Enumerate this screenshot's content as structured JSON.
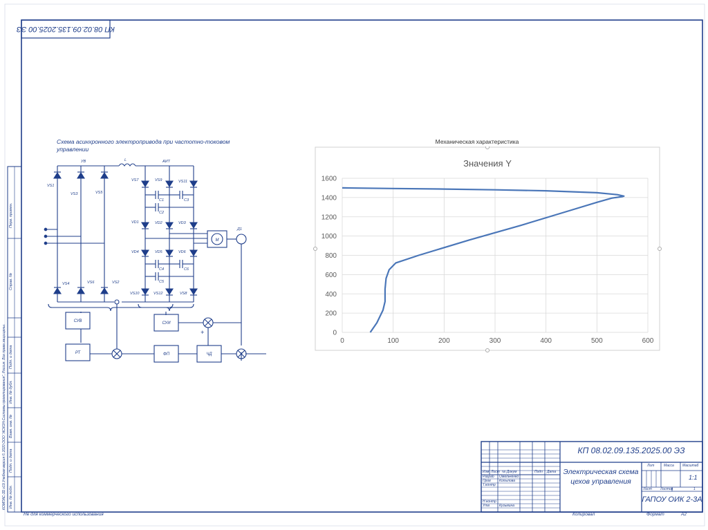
{
  "sheet": {
    "top_code": "КП 08.02.09.135.2025.00 ЭЗ",
    "bottom_left_note": "Не для коммерческого использования",
    "bottom_copied": "Копировал",
    "bottom_format": "Формат",
    "bottom_format_value": "А2",
    "left_strip": {
      "perv_primen": "Перв. примен.",
      "sprav_no": "Справ. №",
      "podp_data_1": "Подп. и дата",
      "inv_dubl": "Инв. № дубл.",
      "vzam_inv": "Взам. инв. №",
      "podp_data_2": "Подп. и дата",
      "inv_podl": "Инв. № подл.",
      "license_note": "КОМПАС-3D v19 Учебная версия © 2020 ООО \"АСКОН-Системы проектирования\", Россия. Все права защищены."
    }
  },
  "schematic": {
    "title_line1": "Схема асинхронного электропривода при частотно-токовом",
    "title_line2": "управлении",
    "labels": {
      "uv": "УВ",
      "l": "L",
      "ain": "АИТ",
      "m": "М",
      "d1": "Д1",
      "su": "СУВ",
      "rt": "РТ",
      "fp": "ФП",
      "chd": "ЧД",
      "sui": "СУИ",
      "vs1": "VS1",
      "vs3": "VS3",
      "vs5": "VS5",
      "vs4": "VS4",
      "vs6": "VS6",
      "vs2": "VS2",
      "vs7": "VS7",
      "vs9": "VS9",
      "vs11": "VS11",
      "vd1": "VD1",
      "vd2": "VD2",
      "vd3": "VD3",
      "vd4": "VD4",
      "vd5": "VD5",
      "vd6": "VD6",
      "vs10": "VS10",
      "vs12": "VS12",
      "vs8": "VS8",
      "c1": "C1",
      "c2": "C2",
      "c3": "C3",
      "c4": "C4",
      "c5": "C5",
      "c6": "C6",
      "plus": "+"
    }
  },
  "chart_caption": "Механическая характеристика",
  "chart_data": {
    "type": "line",
    "title": "Значения Y",
    "xlabel": "",
    "ylabel": "",
    "xlim": [
      0,
      600
    ],
    "ylim": [
      0,
      1600
    ],
    "xticks": [
      0,
      100,
      200,
      300,
      400,
      500,
      600
    ],
    "yticks": [
      0,
      200,
      400,
      600,
      800,
      1000,
      1200,
      1400,
      1600
    ],
    "grid": true,
    "legend": "none",
    "color": "#4a76b8",
    "series": [
      {
        "points": [
          [
            55,
            0
          ],
          [
            68,
            100
          ],
          [
            80,
            230
          ],
          [
            84,
            320
          ],
          [
            84,
            450
          ],
          [
            86,
            560
          ],
          [
            92,
            650
          ],
          [
            105,
            720
          ],
          [
            150,
            800
          ],
          [
            250,
            960
          ],
          [
            350,
            1110
          ],
          [
            450,
            1270
          ],
          [
            500,
            1350
          ],
          [
            530,
            1395
          ],
          [
            550,
            1410
          ],
          [
            553,
            1415
          ],
          [
            540,
            1430
          ],
          [
            500,
            1450
          ],
          [
            400,
            1470
          ],
          [
            300,
            1480
          ],
          [
            200,
            1488
          ],
          [
            100,
            1494
          ],
          [
            0,
            1500
          ]
        ]
      }
    ]
  },
  "title_block": {
    "doc_code": "КП 08.02.09.135.2025.00 ЭЗ",
    "doc_title_line1": "Электрическая схема",
    "doc_title_line2": "цехов управления",
    "org": "ГАПОУ ОИК 2-3А",
    "col_izm": "Изм",
    "col_list": "Лист",
    "col_docum": "№ Докум",
    "col_podp": "Подп",
    "col_data": "Дата",
    "razrab": "Разраб",
    "razrab_name": "Омельченко",
    "prov": "Пров",
    "prov_name": "Копылова",
    "t_kontr": "Т.контр",
    "n_kontr": "Н.контр",
    "utv": "Утв",
    "utv_name": "Кузьмина",
    "lit": "Лит",
    "massa": "Масса",
    "masshtab": "Масштаб",
    "masshtab_value": "1:1",
    "list": "Лист",
    "listov": "Листов",
    "listov_value": "1"
  }
}
